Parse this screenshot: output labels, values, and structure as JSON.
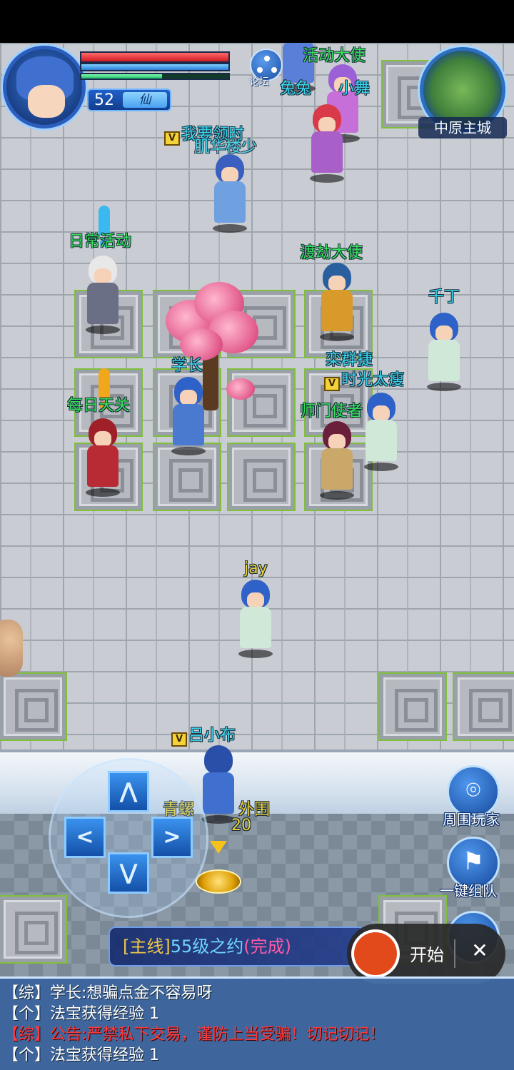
{
  "player": {
    "level": "52",
    "rank": "仙",
    "hp_fraction": 1.0,
    "mp_fraction": 1.0,
    "exp_fraction": 0.55
  },
  "forum": {
    "label": "论坛"
  },
  "minimap": {
    "location": "中原主城"
  },
  "npcs": {
    "activity_envoy": "活动大使",
    "player_tutu": "兔兔",
    "player_xiaowu": "小舞",
    "daily_activity": "日常活动",
    "dujie_envoy": "渡劫大使",
    "daily_pass": "每日天关",
    "sect_envoy": "师门使者"
  },
  "players": {
    "overlap_name": "我要领时",
    "overlap_name2": "肌华楼少",
    "xuezhang": "学长",
    "qianding": "千丁",
    "luanqunjie": "栾群捷",
    "shiguang": "时光太瘦",
    "jay": "jay",
    "self": "吕小布",
    "area_label": "青螺",
    "area_label2": "外围",
    "area_number": "20"
  },
  "controls": {
    "dpad_up": "⋀",
    "dpad_down": "⋁",
    "dpad_left": "<",
    "dpad_right": ">",
    "nearby_players": "周围玩家",
    "one_click_team": "一键组队"
  },
  "quest": {
    "tag": "[主线]",
    "title": "55级之约",
    "state": "(完成)"
  },
  "recorder": {
    "start_label": "开始",
    "close_label": "✕"
  },
  "chat": [
    {
      "channel": "【综】",
      "text": "学长:想骗点金不容易呀",
      "alert": false
    },
    {
      "channel": "【个】",
      "text": "法宝获得经验 1",
      "alert": false
    },
    {
      "channel": "【综】",
      "text": "公告:严禁私下交易，谨防上当受骗！切记切记！",
      "alert": true
    },
    {
      "channel": "【个】",
      "text": "法宝获得经验 1",
      "alert": false
    }
  ],
  "colors": {
    "npc_name": "#35e35a",
    "player_name": "#3ad8f0",
    "self_name": "#3ad8f0",
    "quest_tag": "#f0c64a",
    "alert": "#ff3b3b"
  },
  "icons": {
    "nearby": "map-pin-icon",
    "team": "flag-plus-icon",
    "forum": "share-nodes-icon"
  }
}
